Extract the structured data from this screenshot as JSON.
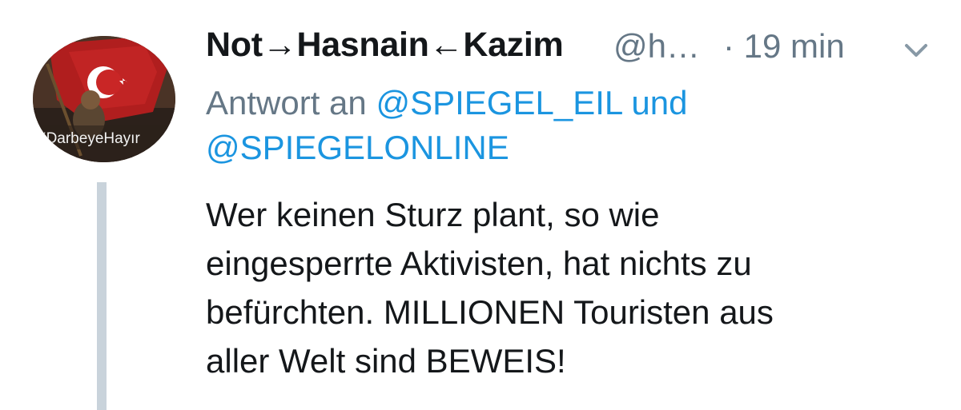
{
  "tweet": {
    "author_name": "Not→Hasnain←Kazim",
    "author_handle": "@h…",
    "time_sep": "·",
    "time": "19 min",
    "reply_prefix": "Antwort an",
    "reply_mention_1": "@SPIEGEL_EIL",
    "reply_conjunction": "und",
    "reply_mention_2": "@SPIEGELONLINE",
    "text_lines": [
      "Wer keinen Sturz plant, so wie",
      "eingesperrte Aktivisten, hat nichts zu",
      "befürchten. MILLIONEN Touristen aus",
      "aller Welt sind BEWEIS!"
    ],
    "avatar_hashtag": "#DarbeyeHayır",
    "menu_icon": "chevron-down-icon"
  },
  "colors": {
    "name": "#14171a",
    "secondary": "#657786",
    "link": "#1b95e0",
    "thread_line": "#c9d3db"
  }
}
